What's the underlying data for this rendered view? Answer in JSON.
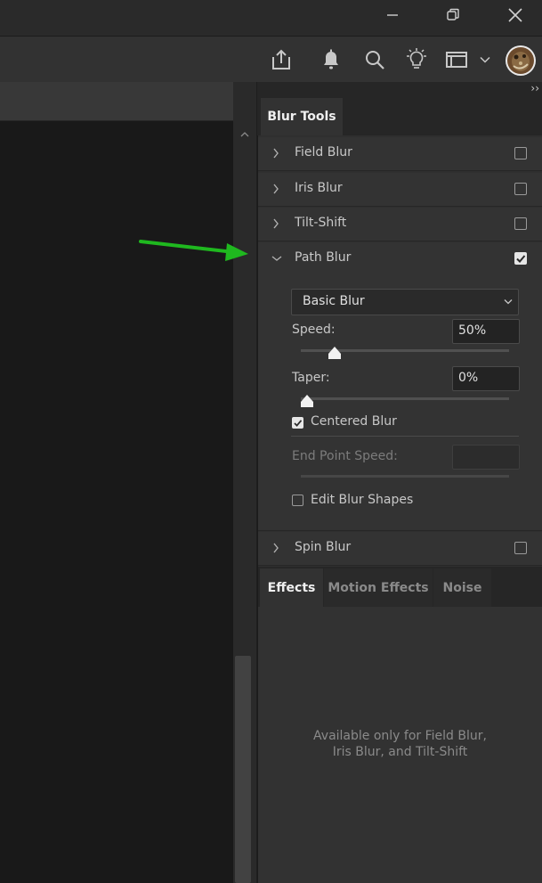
{
  "window": {
    "icons": [
      "minimize-icon",
      "restore-icon",
      "close-icon"
    ]
  },
  "appbar": {
    "icons": [
      "share-icon",
      "bell-icon",
      "search-icon",
      "lightbulb-icon",
      "workspace-icon",
      "chevron-down-icon",
      "avatar"
    ]
  },
  "panel": {
    "title_tab": "Blur Tools",
    "collapse_glyph": "››",
    "rows": [
      {
        "label": "Field Blur",
        "checked": false,
        "expanded": false
      },
      {
        "label": "Iris Blur",
        "checked": false,
        "expanded": false
      },
      {
        "label": "Tilt-Shift",
        "checked": false,
        "expanded": false
      },
      {
        "label": "Path Blur",
        "checked": true,
        "expanded": true
      },
      {
        "label": "Spin Blur",
        "checked": false,
        "expanded": false
      }
    ],
    "path_blur": {
      "mode": "Basic Blur",
      "speed_label": "Speed:",
      "speed_value": "50%",
      "speed_fraction": 0.5,
      "taper_label": "Taper:",
      "taper_value": "0%",
      "taper_fraction": 0.0,
      "centered_label": "Centered Blur",
      "centered_checked": true,
      "endpoint_label": "End Point Speed:",
      "endpoint_value": "",
      "edit_shapes_label": "Edit Blur Shapes",
      "edit_shapes_checked": false
    }
  },
  "effects": {
    "tabs": [
      "Effects",
      "Motion Effects",
      "Noise"
    ],
    "active_tab": "Effects",
    "note_line1": "Available only for Field Blur,",
    "note_line2": "Iris Blur, and Tilt-Shift"
  },
  "colors": {
    "annotation_arrow": "#1fb81f",
    "panel_bg": "#333333",
    "canvas_bg": "#191919"
  }
}
